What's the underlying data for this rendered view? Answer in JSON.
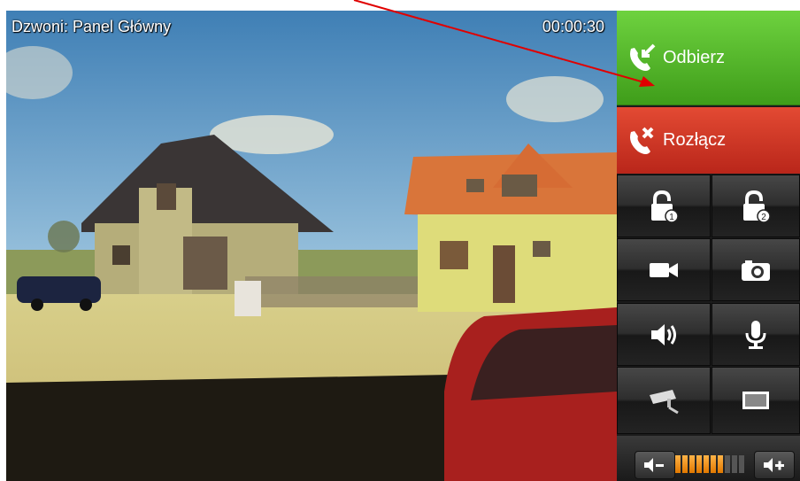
{
  "header": {
    "caller_label": "Dzwoni: Panel Główny",
    "call_timer": "00:00:30"
  },
  "controls": {
    "answer_label": "Odbierz",
    "hangup_label": "Rozłącz",
    "answer_color": "#4caf22",
    "hangup_color": "#c93022",
    "grid": [
      {
        "name": "unlock-1-button",
        "icon": "padlock-1-icon"
      },
      {
        "name": "unlock-2-button",
        "icon": "padlock-2-icon"
      },
      {
        "name": "record-video-button",
        "icon": "video-camera-icon"
      },
      {
        "name": "snapshot-button",
        "icon": "photo-camera-icon"
      },
      {
        "name": "speaker-button",
        "icon": "speaker-icon"
      },
      {
        "name": "microphone-button",
        "icon": "microphone-icon"
      },
      {
        "name": "cctv-button",
        "icon": "cctv-camera-icon"
      },
      {
        "name": "fullscreen-button",
        "icon": "screen-icon"
      }
    ],
    "volume": {
      "level": 0.7,
      "segments": 10,
      "active_color": "#f08a10"
    }
  },
  "annotation": {
    "arrow_color": "#e00000"
  }
}
